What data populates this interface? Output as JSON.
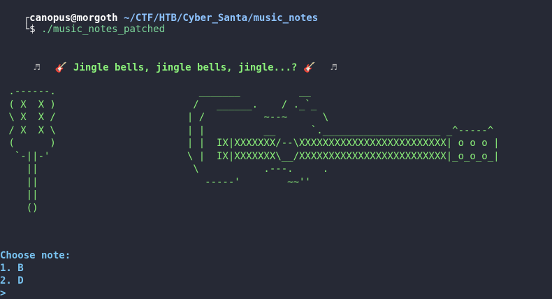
{
  "prompt": {
    "open_bracket": "┌",
    "corner": "└",
    "user": "canopus",
    "at": "@",
    "host": "morgoth",
    "path": "~/CTF/HTB/Cyber_Santa/music_notes",
    "dollar": "$",
    "command": "./music_notes_patched"
  },
  "banner": {
    "left_note": "♬",
    "left_guitar": "🎸",
    "text": "Jingle bells, jingle bells, jingle...?",
    "right_guitar": "🎸",
    "right_note": "♬"
  },
  "ascii_maraca": " .------.\n ( X  X )\n \\ X  X /\n / X  X \\\n (      )\n  `-||-'\n    ||\n    ||\n    ||\n    ()",
  "ascii_guitar": "           _______          __\n          /   ______.    / ._`_\n         | /          ~--~      \\\n         | |          __      `.____________________ _^-----^\n         | |  IX|XXXXXXX/--\\XXXXXXXXXXXXXXXXXXXXXXXXX| o o o |\n         \\ |  IX|XXXXXXX\\__/XXXXXXXXXXXXXXXXXXXXXXXXX|_o_o_o_|\n          \\           .---.     .\n            -----'        ~~''",
  "menu": {
    "title": "Choose note:",
    "options": [
      "1. B",
      "2. D"
    ],
    "caret": ">"
  }
}
